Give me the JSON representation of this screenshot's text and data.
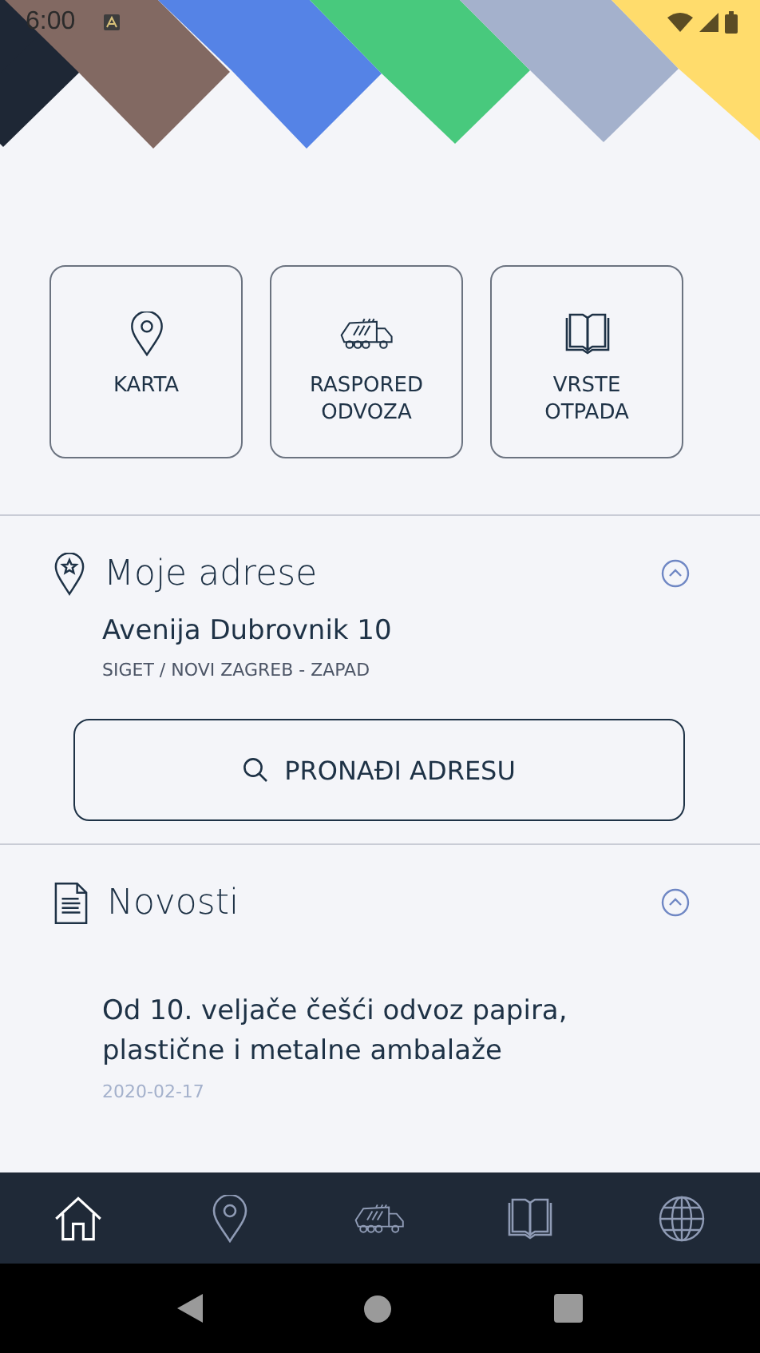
{
  "status_bar": {
    "time": "6:00"
  },
  "tiles": [
    {
      "kind": "map",
      "label": "KARTA"
    },
    {
      "kind": "truck",
      "label": "RASPORED ODVOZA"
    },
    {
      "kind": "book",
      "label": "VRSTE OTPADA"
    }
  ],
  "addresses": {
    "title": "Moje adrese",
    "expanded": true,
    "items": [
      {
        "street": "Avenija Dubrovnik 10",
        "district": "SIGET / NOVI ZAGREB - ZAPAD"
      }
    ],
    "button": "PRONAĐI ADRESU"
  },
  "news": {
    "title": "Novosti",
    "expanded": true,
    "items": [
      {
        "title": "Od 10. veljače češći odvoz papira, plastične i metalne ambalaže",
        "date": "2020-02-17"
      }
    ]
  },
  "bottom_nav": [
    {
      "kind": "home",
      "selected": true
    },
    {
      "kind": "map",
      "selected": false
    },
    {
      "kind": "truck",
      "selected": false
    },
    {
      "kind": "book",
      "selected": false
    },
    {
      "kind": "globe",
      "selected": false
    }
  ]
}
